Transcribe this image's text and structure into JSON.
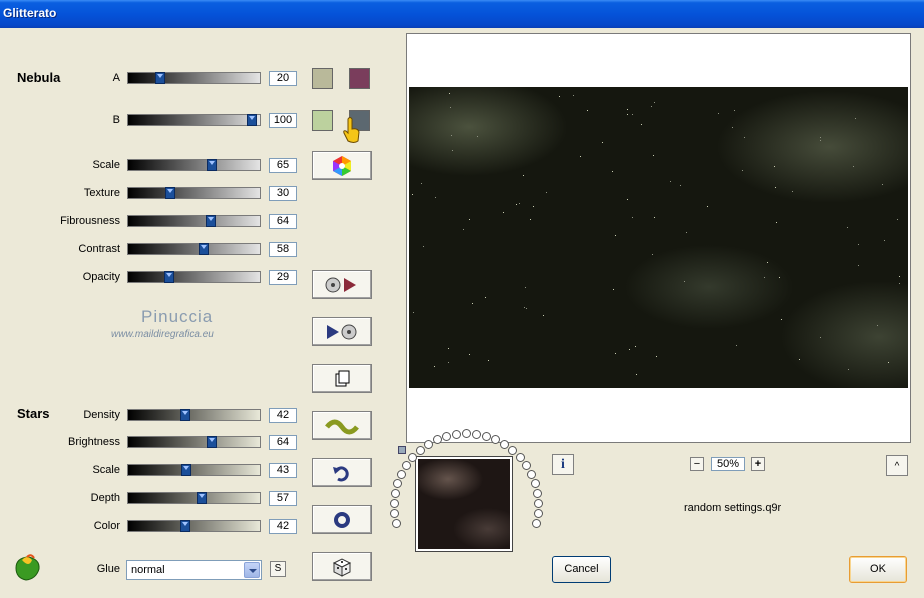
{
  "window": {
    "title": "Glitterato"
  },
  "nebula": {
    "title": "Nebula",
    "sliders": [
      {
        "label": "A",
        "value": "20",
        "pos": 0.22
      },
      {
        "label": "B",
        "value": "100",
        "pos": 0.96
      },
      {
        "label": "Scale",
        "value": "65",
        "pos": 0.64
      },
      {
        "label": "Texture",
        "value": "30",
        "pos": 0.3
      },
      {
        "label": "Fibrousness",
        "value": "64",
        "pos": 0.63
      },
      {
        "label": "Contrast",
        "value": "58",
        "pos": 0.57
      },
      {
        "label": "Opacity",
        "value": "29",
        "pos": 0.29
      }
    ],
    "swatches": {
      "a1": "#b9b99a",
      "a2": "#7a3d5c",
      "b1": "#bcd19e",
      "b2": "#5c6870"
    }
  },
  "stars": {
    "title": "Stars",
    "sliders": [
      {
        "label": "Density",
        "value": "42",
        "pos": 0.42
      },
      {
        "label": "Brightness",
        "value": "64",
        "pos": 0.64
      },
      {
        "label": "Scale",
        "value": "43",
        "pos": 0.43
      },
      {
        "label": "Depth",
        "value": "57",
        "pos": 0.56
      },
      {
        "label": "Color",
        "value": "42",
        "pos": 0.42
      }
    ]
  },
  "glue": {
    "label": "Glue",
    "value": "normal",
    "s_label": "S"
  },
  "watermark": {
    "name": "Pinuccia",
    "url": "www.maildiregrafica.eu"
  },
  "toolbar": {
    "icons": [
      "color-wheel-icon",
      "play-forward-icon",
      "play-back-icon",
      "copy-icon",
      "wave-icon",
      "undo-icon",
      "reset-ring-icon",
      "dice-icon"
    ]
  },
  "preview": {
    "zoom": "50%",
    "minus": "−",
    "plus": "+",
    "info": "i",
    "up": "^"
  },
  "status": {
    "file": "random settings.q9r"
  },
  "buttons": {
    "cancel": "Cancel",
    "ok": "OK"
  },
  "colors": {
    "title_bar": "#0553d9",
    "dialog_bg": "#ece9d8",
    "accent": "#1b4f9a"
  }
}
